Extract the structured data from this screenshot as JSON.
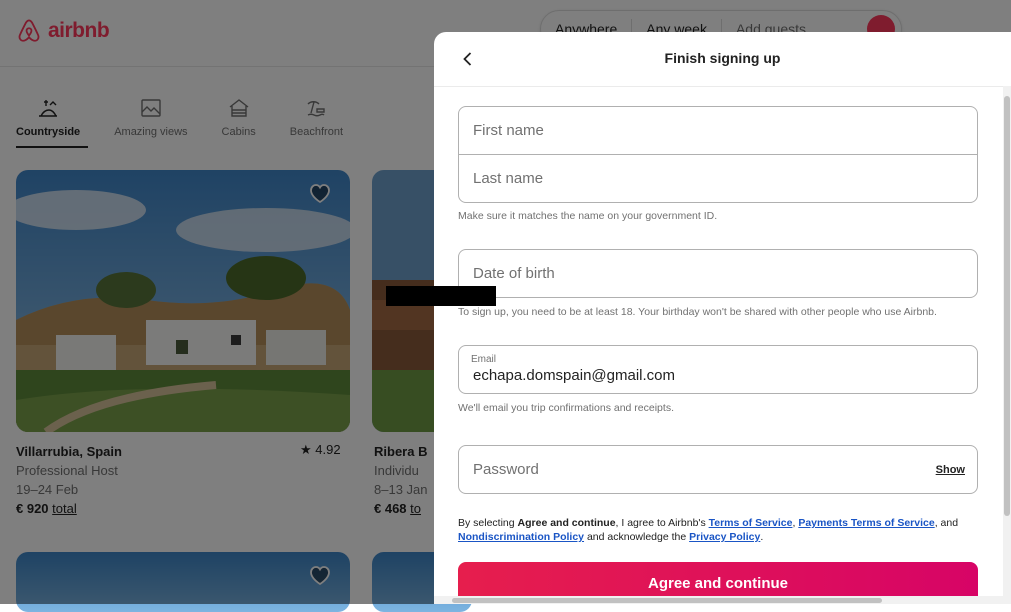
{
  "brand": {
    "name": "airbnb",
    "color": "#ff385c"
  },
  "search": {
    "where": "Anywhere",
    "when": "Any week",
    "guests": "Add guests"
  },
  "categories": [
    {
      "label": "Countryside",
      "icon": "countryside-icon",
      "active": true
    },
    {
      "label": "Amazing views",
      "icon": "amazing-views-icon"
    },
    {
      "label": "Cabins",
      "icon": "cabins-icon"
    },
    {
      "label": "Beachfront",
      "icon": "beachfront-icon"
    }
  ],
  "listings": [
    {
      "title": "Villarrubia, Spain",
      "host": "Professional Host",
      "dates": "19–24 Feb",
      "price": "€ 920",
      "price_suffix": "total",
      "rating": "4.92"
    },
    {
      "title": "Ribera B",
      "host": "Individu",
      "dates": "8–13 Jan",
      "price": "€ 468",
      "price_suffix": "to"
    }
  ],
  "modal": {
    "title": "Finish signing up",
    "first_name_placeholder": "First name",
    "last_name_placeholder": "Last name",
    "name_helper": "Make sure it matches the name on your government ID.",
    "dob_placeholder": "Date of birth",
    "dob_helper": "To sign up, you need to be at least 18. Your birthday won't be shared with other people who use Airbnb.",
    "email_label": "Email",
    "email_value": "echapa.domspain@gmail.com",
    "email_helper": "We'll email you trip confirmations and receipts.",
    "password_placeholder": "Password",
    "show_label": "Show",
    "legal": {
      "p1": "By selecting ",
      "bold": "Agree and continue",
      "p2": ", I agree to Airbnb's ",
      "terms": "Terms of Service",
      "sep1": ", ",
      "payments": "Payments Terms of Service",
      "p3": ", and ",
      "nondiscrimination": "Nondiscrimination Policy",
      "p4": " and acknowledge the ",
      "privacy": "Privacy Policy",
      "p5": "."
    },
    "agree_button": "Agree and continue"
  }
}
